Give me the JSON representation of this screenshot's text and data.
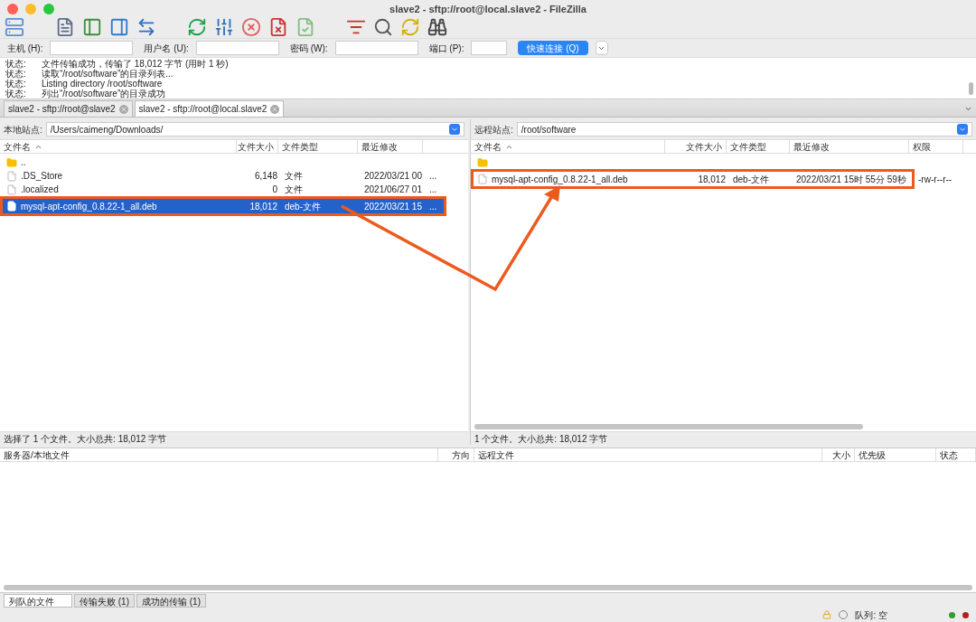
{
  "window": {
    "title": "slave2 - sftp://root@local.slave2 - FileZilla"
  },
  "quickconnect": {
    "fields": [
      {
        "label": "主机 (H):"
      },
      {
        "label": "用户名 (U):"
      },
      {
        "label": "密码 (W):"
      },
      {
        "label": "端口 (P):"
      }
    ],
    "button": "快速连接 (Q)"
  },
  "log": [
    {
      "label": "状态:",
      "message": "文件传输成功，传输了 18,012 字节 (用时 1 秒)"
    },
    {
      "label": "状态:",
      "message": "读取“/root/software”的目录列表..."
    },
    {
      "label": "状态:",
      "message": "Listing directory /root/software"
    },
    {
      "label": "状态:",
      "message": "列出“/root/software”的目录成功"
    }
  ],
  "tabs": [
    {
      "label": "slave2 - sftp://root@slave2",
      "selected": false
    },
    {
      "label": "slave2 - sftp://root@local.slave2",
      "selected": true
    }
  ],
  "local": {
    "label": "本地站点:",
    "path": "/Users/caimeng/Downloads/",
    "columns": [
      "文件名",
      "文件大小",
      "文件类型",
      "最近修改"
    ],
    "rows": [
      {
        "kind": "folder",
        "name": "..",
        "selected": false,
        "highlighted": false
      },
      {
        "kind": "file",
        "name": ".DS_Store",
        "size": "6,148",
        "type": "文件",
        "modified": "2022/03/21 00",
        "extra": "...",
        "selected": false,
        "highlighted": false
      },
      {
        "kind": "file",
        "name": ".localized",
        "size": "0",
        "type": "文件",
        "modified": "2021/06/27 01",
        "extra": "...",
        "selected": false,
        "highlighted": false
      },
      {
        "kind": "file",
        "name": "mysql-apt-config_0.8.22-1_all.deb",
        "size": "18,012",
        "type": "deb-文件",
        "modified": "2022/03/21 15",
        "extra": "...",
        "selected": true,
        "highlighted": true
      }
    ],
    "status": "选择了 1 个文件。大小总共: 18,012 字节"
  },
  "remote": {
    "label": "远程站点:",
    "path": "/root/software",
    "columns": [
      "文件名",
      "文件大小",
      "文件类型",
      "最近修改",
      "权限"
    ],
    "rows": [
      {
        "kind": "folder",
        "selected": false,
        "highlighted": false
      },
      {
        "kind": "file",
        "name": "mysql-apt-config_0.8.22-1_all.deb",
        "size": "18,012",
        "type": "deb-文件",
        "modified": "2022/03/21 15时 55分 59秒",
        "permissions": "-rw-r--r--",
        "selected": false,
        "highlighted": true
      }
    ],
    "status": "1 个文件。大小总共: 18,012 字节"
  },
  "queue": {
    "columns": [
      "服务器/本地文件",
      "方向",
      "远程文件",
      "大小",
      "优先级",
      "状态"
    ]
  },
  "queue_tabs": [
    {
      "label": "列队的文件",
      "selected": true
    },
    {
      "label": "传输失败 (1)",
      "selected": false
    },
    {
      "label": "成功的传输 (1)",
      "selected": false
    }
  ],
  "status_bar": {
    "queue": "队列: 空"
  }
}
